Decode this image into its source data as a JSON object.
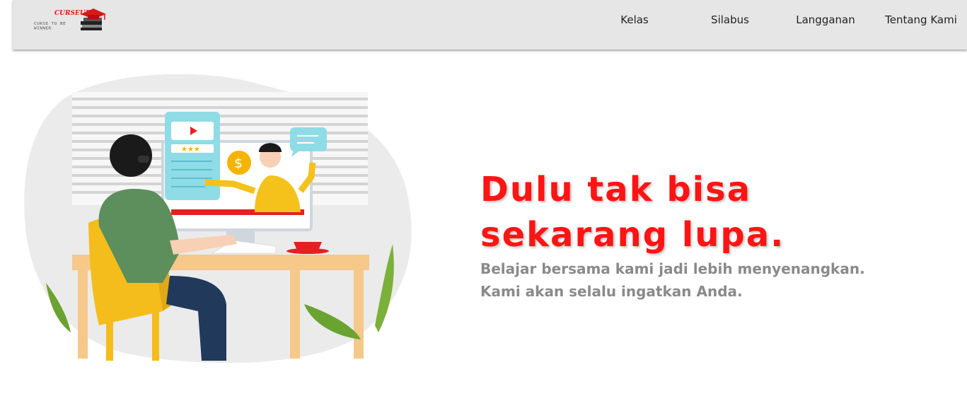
{
  "logo": {
    "brand": "CURSEUP",
    "tagline": "CURSE TO BE WINNER"
  },
  "nav": {
    "items": [
      {
        "label": "Kelas"
      },
      {
        "label": "Silabus"
      },
      {
        "label": "Langganan"
      },
      {
        "label": "Tentang Kami"
      }
    ]
  },
  "hero": {
    "headline": "Dulu tak bisa sekarang lupa.",
    "subline_1": "Belajar bersama kami jadi lebih menyenangkan.",
    "subline_2": "Kami akan selalu ingatkan Anda."
  },
  "colors": {
    "accent": "#ff1414",
    "navbar_bg": "#e6e6e6",
    "subtext": "#8a8a8a"
  }
}
